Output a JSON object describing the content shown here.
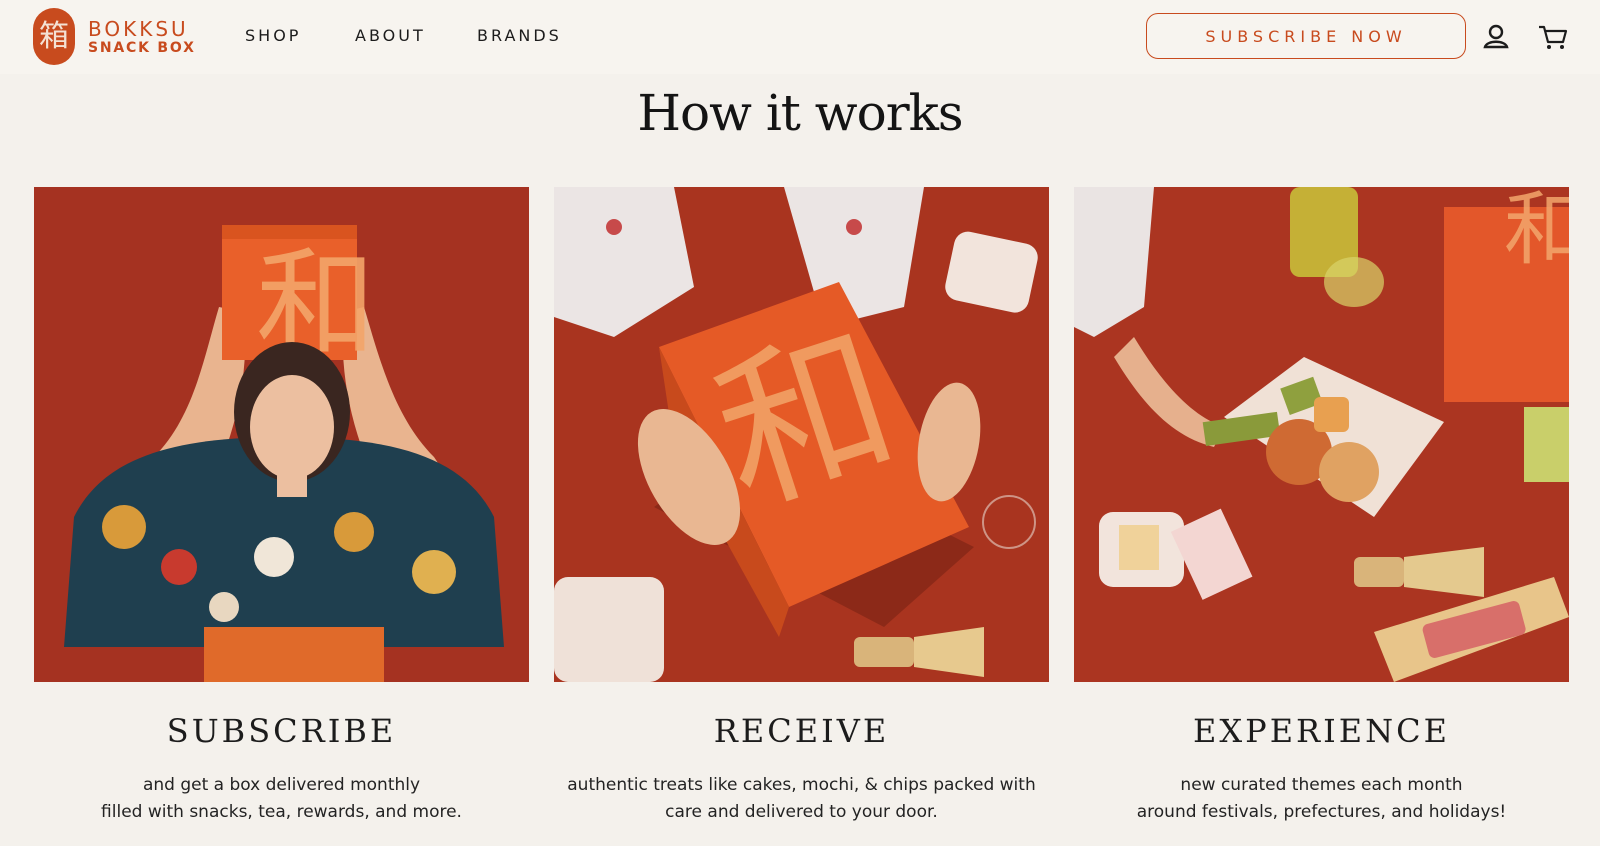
{
  "brand": {
    "seal_glyph": "箱",
    "name_line1": "BOKKSU",
    "name_line2": "SNACK BOX",
    "color": "#c84b1e"
  },
  "nav": {
    "items": [
      {
        "label": "SHOP"
      },
      {
        "label": "ABOUT"
      },
      {
        "label": "BRANDS"
      }
    ]
  },
  "header": {
    "subscribe_label": "SUBSCRIBE NOW",
    "account_icon": "account-icon",
    "cart_icon": "cart-icon"
  },
  "main": {
    "title": "How it works",
    "steps": [
      {
        "heading": "SUBSCRIBE",
        "lines": [
          "and get a box delivered monthly",
          "filled with snacks, tea, rewards, and more."
        ]
      },
      {
        "heading": "RECEIVE",
        "lines": [
          "authentic treats like cakes, mochi, & chips packed with",
          "care and delivered to your door."
        ]
      },
      {
        "heading": "EXPERIENCE",
        "lines": [
          "new curated themes each month",
          "around festivals, prefectures, and holidays!"
        ]
      }
    ]
  },
  "colors": {
    "background": "#f4f1ec",
    "accent": "#c84b1e",
    "photo_red": "#a5301f",
    "box_orange": "#e25a26"
  }
}
